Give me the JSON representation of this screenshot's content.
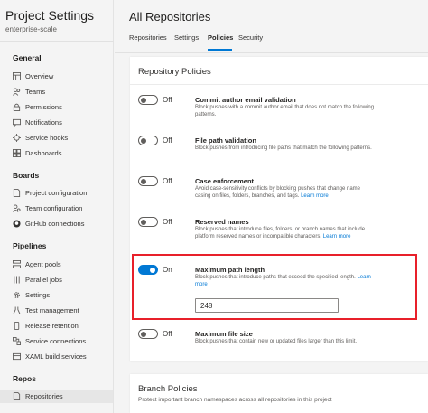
{
  "sidebar": {
    "title": "Project Settings",
    "subtitle": "enterprise-scale",
    "sections": {
      "general": "General",
      "boards": "Boards",
      "pipelines": "Pipelines",
      "repos": "Repos"
    },
    "general_items": [
      {
        "label": "Overview",
        "icon": "overview-icon"
      },
      {
        "label": "Teams",
        "icon": "teams-icon"
      },
      {
        "label": "Permissions",
        "icon": "lock-icon"
      },
      {
        "label": "Notifications",
        "icon": "notification-icon"
      },
      {
        "label": "Service hooks",
        "icon": "service-hooks-icon"
      },
      {
        "label": "Dashboards",
        "icon": "dashboard-icon"
      }
    ],
    "boards_items": [
      {
        "label": "Project configuration",
        "icon": "document-icon"
      },
      {
        "label": "Team configuration",
        "icon": "team-config-icon"
      },
      {
        "label": "GitHub connections",
        "icon": "github-icon"
      }
    ],
    "pipelines_items": [
      {
        "label": "Agent pools",
        "icon": "agent-pools-icon"
      },
      {
        "label": "Parallel jobs",
        "icon": "parallel-jobs-icon"
      },
      {
        "label": "Settings",
        "icon": "gear-icon"
      },
      {
        "label": "Test management",
        "icon": "test-management-icon"
      },
      {
        "label": "Release retention",
        "icon": "phone-icon"
      },
      {
        "label": "Service connections",
        "icon": "service-connections-icon"
      },
      {
        "label": "XAML build services",
        "icon": "xaml-build-icon"
      }
    ],
    "repos_items": [
      {
        "label": "Repositories",
        "icon": "document-icon",
        "active": true
      }
    ]
  },
  "main": {
    "title": "All Repositories",
    "tabs": [
      {
        "label": "Repositories"
      },
      {
        "label": "Settings"
      },
      {
        "label": "Policies",
        "active": true
      },
      {
        "label": "Security"
      }
    ]
  },
  "repo_policies": {
    "title": "Repository Policies",
    "policies": [
      {
        "toggle": "Off",
        "name": "Commit author email validation",
        "description": "Block pushes with a commit author email that does not match the following patterns."
      },
      {
        "toggle": "Off",
        "name": "File path validation",
        "description": "Block pushes from introducing file paths that match the following patterns."
      },
      {
        "toggle": "Off",
        "name": "Case enforcement",
        "description": "Avoid case-sensitivity conflicts by blocking pushes that change name casing on files, folders, branches, and tags.",
        "link": "Learn more"
      },
      {
        "toggle": "Off",
        "name": "Reserved names",
        "description": "Block pushes that introduce files, folders, or branch names that include platform reserved names or incompatible characters.",
        "link": "Learn more"
      },
      {
        "toggle": "On",
        "name": "Maximum path length",
        "description": "Block pushes that introduce paths that exceed the specified length.",
        "link": "Learn more",
        "value": "248"
      },
      {
        "toggle": "Off",
        "name": "Maximum file size",
        "description": "Block pushes that contain new or updated files larger than this limit."
      }
    ]
  },
  "branch_policies": {
    "title": "Branch Policies",
    "subtitle": "Protect important branch namespaces across all repositories in this project"
  },
  "colors": {
    "accent": "#0078d4",
    "highlight": "#e8202a"
  }
}
